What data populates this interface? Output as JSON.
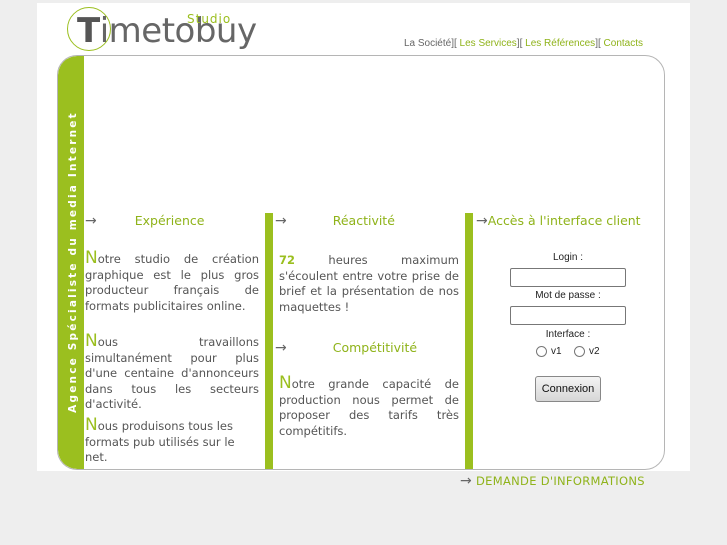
{
  "logo": {
    "brand_first": "T",
    "brand_rest": "imetobuy",
    "studio": "Studio"
  },
  "nav": {
    "items": [
      "La Société",
      "Les Services",
      "Les Références",
      "Contacts"
    ],
    "left_bracket": "[",
    "right_bracket": "]"
  },
  "sidebar": {
    "tagline": "Agence Spécialiste du media Internet"
  },
  "experience": {
    "title": "Expérience",
    "p1_cap": "N",
    "p1": "otre studio de création graphique est le plus gros producteur français de formats publicitaires online.",
    "p2_cap": "N",
    "p2": "ous travaillons simultanément pour plus d'une centaine d'annonceurs dans tous les secteurs d'activité.",
    "p3_cap": "N",
    "p3": "ous produisons tous les formats pub utilisés sur le net."
  },
  "reactivite": {
    "title": "Réactivité",
    "num": "72",
    "text": " heures maximum s'écoulent entre votre prise de brief et la présentation de nos maquettes !"
  },
  "competitivite": {
    "title": "Compétitivité",
    "cap": "N",
    "text": "otre grande capacité de production nous permet de proposer des tarifs très compétitifs."
  },
  "client": {
    "title": "Accès à l'interface client",
    "login_label": "Login :",
    "login_value": "",
    "password_label": "Mot de passe :",
    "password_value": "",
    "interface_label": "Interface :",
    "options": [
      "v1",
      "v2"
    ],
    "submit": "Connexion"
  },
  "footer": {
    "cta": "DEMANDE D'INFORMATIONS"
  },
  "colors": {
    "accent": "#9bbf1f",
    "text": "#555555",
    "frame": "#b5b5b5",
    "background": "#eeeeee"
  },
  "icons": {
    "arrow": "arrow-right-icon",
    "radio": "radio-icon"
  }
}
